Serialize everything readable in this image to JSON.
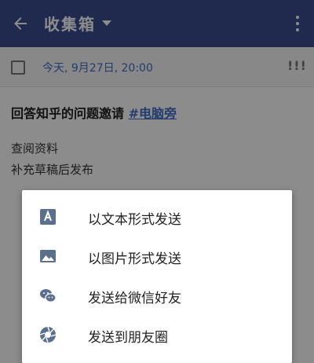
{
  "appbar": {
    "title": "收集箱",
    "background": "#3a4d8f"
  },
  "note": {
    "date": "今天, 9月27日, 20:00",
    "priority": "!!!",
    "title_text": "回答知乎的问题邀请 ",
    "title_tag": "#电脑旁",
    "lines": [
      "查阅资料",
      "补充草稿后发布"
    ]
  },
  "share_sheet": {
    "items": [
      {
        "label": "以文本形式发送",
        "icon": "text-letter-icon"
      },
      {
        "label": "以图片形式发送",
        "icon": "image-icon"
      },
      {
        "label": "发送给微信好友",
        "icon": "wechat-icon"
      },
      {
        "label": "发送到朋友圈",
        "icon": "moments-shutter-icon"
      }
    ]
  },
  "colors": {
    "accent": "#3f6ec9",
    "icon": "#5b6f8f"
  }
}
